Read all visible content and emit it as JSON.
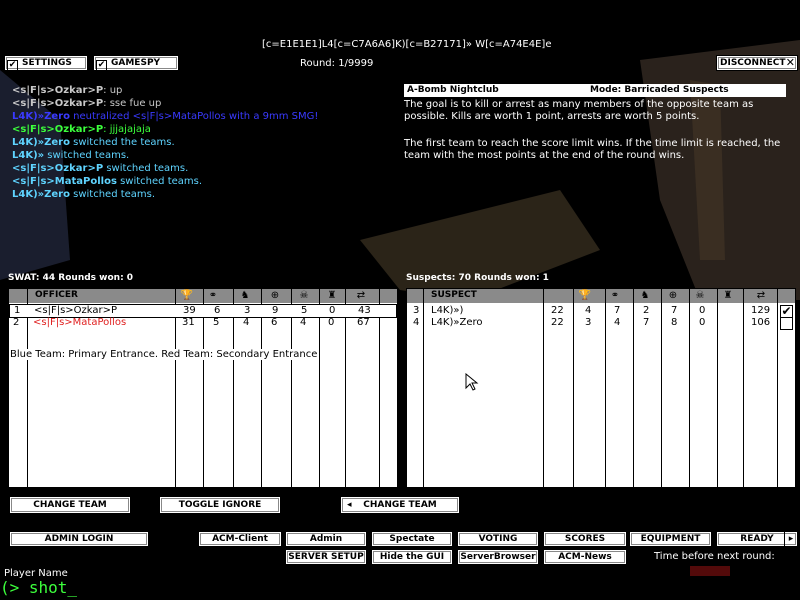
{
  "top": {
    "server_name": "[c=E1E1E1]L4[c=C7A6A6]K)[c=B27171]» W[c=A74E4E]e",
    "round": "Round: 1/9999",
    "settings_label": "SETTINGS",
    "gamespy_label": "GAMESPY",
    "disconnect_label": "DISCONNECT"
  },
  "chat": [
    {
      "name": "<s|F|s>Ozkar>P",
      "text": ": up",
      "name_color": "#c8c8c8",
      "text_color": "#c8c8c8"
    },
    {
      "name": "<s|F|s>Ozkar>P",
      "text": ": sse fue up",
      "name_color": "#c8c8c8",
      "text_color": "#c8c8c8"
    },
    {
      "name": "L4K)»Zero",
      "text": " neutralized <s|F|s>MataPollos with a 9mm SMG!",
      "name_color": "#3a3aff",
      "text_color": "#3a3aff"
    },
    {
      "name": "<s|F|s>Ozkar>P",
      "text": ": jjjajajaja",
      "name_color": "#3cff3c",
      "text_color": "#3cff3c"
    },
    {
      "name": "L4K)»Zero",
      "text": " switched the teams.",
      "name_color": "#5fd4ff",
      "text_color": "#5fd4ff"
    },
    {
      "name": "L4K)»",
      "text": " switched teams.",
      "name_color": "#5fd4ff",
      "text_color": "#5fd4ff"
    },
    {
      "name": "<s|F|s>Ozkar>P",
      "text": " switched teams.",
      "name_color": "#5fd4ff",
      "text_color": "#5fd4ff"
    },
    {
      "name": "<s|F|s>MataPollos",
      "text": " switched teams.",
      "name_color": "#5fd4ff",
      "text_color": "#5fd4ff"
    },
    {
      "name": "L4K)»Zero",
      "text": " switched teams.",
      "name_color": "#5fd4ff",
      "text_color": "#5fd4ff"
    }
  ],
  "mission": {
    "map": "A-Bomb Nightclub",
    "mode": "Mode: Barricaded Suspects",
    "desc1": "The goal is to kill or arrest as many members of the opposite team as possible.  Kills are worth 1 point, arrests are worth 5 points.",
    "desc2": "The first team to reach the score limit wins.  If the time limit is reached, the team with the most points at the end of the round wins."
  },
  "swat": {
    "summary": "SWAT: 44   Rounds won: 0",
    "header": "OFFICER",
    "rows": [
      {
        "num": "1",
        "name": "<s|F|s>Ozkar>P",
        "c1": "39",
        "c2": "6",
        "c3": "3",
        "c4": "9",
        "c5": "5",
        "c6": "0",
        "ping": "43",
        "color": "#000000"
      },
      {
        "num": "2",
        "name": "<s|F|s>MataPollos",
        "c1": "31",
        "c2": "5",
        "c3": "4",
        "c4": "6",
        "c5": "4",
        "c6": "0",
        "ping": "67",
        "color": "#e02020"
      }
    ],
    "note": "Blue Team: Primary Entrance. Red Team: Secondary Entrance"
  },
  "suspects": {
    "summary": "Suspects: 70   Rounds won: 1",
    "header": "SUSPECT",
    "rows": [
      {
        "num": "3",
        "name": "L4K)»)",
        "c1": "22",
        "c2": "4",
        "c3": "7",
        "c4": "2",
        "c5": "7",
        "c6": "0",
        "ping": "129",
        "ready": "✔"
      },
      {
        "num": "4",
        "name": "L4K)»Zero",
        "c1": "22",
        "c2": "3",
        "c3": "4",
        "c4": "7",
        "c5": "8",
        "c6": "0",
        "ping": "106",
        "ready": ""
      }
    ]
  },
  "buttons": {
    "change_team_left": "CHANGE TEAM",
    "toggle_ignore": "TOGGLE IGNORE",
    "change_team_right": "CHANGE TEAM",
    "admin_login": "ADMIN LOGIN",
    "acm_client": "ACM-Client",
    "admin": "Admin",
    "spectate": "Spectate",
    "voting": "VOTING",
    "scores": "SCORES",
    "equipment": "EQUIPMENT",
    "ready": "READY",
    "server_setup": "SERVER SETUP",
    "hide_gui": "Hide the GUI",
    "server_browser": "ServerBrowser",
    "acm_news": "ACM-News"
  },
  "bottom": {
    "time_label": "Time before next round:",
    "player_name_label": "Player Name",
    "console": "(> shot_"
  }
}
